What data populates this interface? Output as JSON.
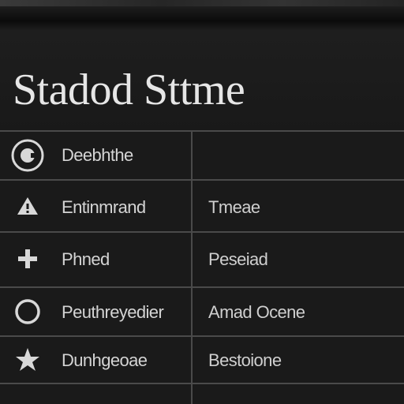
{
  "header": {
    "title": "Stadod Sttme"
  },
  "table": {
    "rows": [
      {
        "icon": "settings-dial-icon",
        "label": "Deebhthe",
        "value": ""
      },
      {
        "icon": "warning-triangle-icon",
        "label": "Entinmrand",
        "value": "Tmeae"
      },
      {
        "icon": "plus-icon",
        "label": "Phned",
        "value": "Peseiad"
      },
      {
        "icon": "circle-icon",
        "label": "Peuthreyedier",
        "value": "Amad Ocene"
      },
      {
        "icon": "star-icon",
        "label": "Dunhgeoae",
        "value": "Bestoione"
      }
    ]
  },
  "colors": {
    "background": "#1a1a1a",
    "text": "#d4d4d4",
    "divider": "#4a4a4a"
  }
}
